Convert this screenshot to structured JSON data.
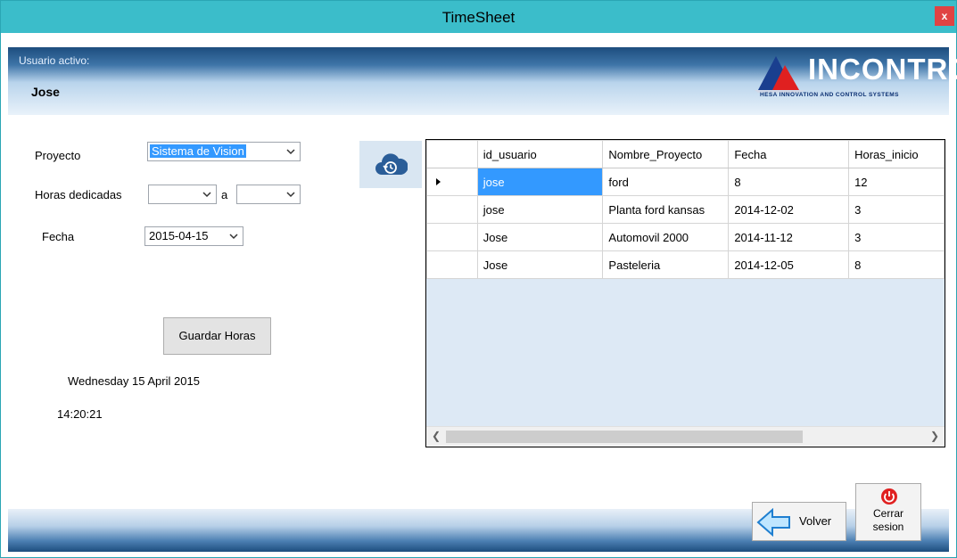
{
  "window": {
    "title": "TimeSheet",
    "close_glyph": "x"
  },
  "header": {
    "user_label": "Usuario activo:",
    "user_name": "Jose",
    "logo": {
      "brand": "INCONTROL",
      "tagline": "HESA INNOVATION AND CONTROL SYSTEMS"
    }
  },
  "form": {
    "proyecto_label": "Proyecto",
    "proyecto_value": "Sistema de Vision",
    "horas_label": "Horas dedicadas",
    "horas_desde": "",
    "horas_sep": "a",
    "horas_hasta": "",
    "fecha_label": "Fecha",
    "fecha_value": "2015-04-15",
    "save_button": "Guardar Horas",
    "date_display": "Wednesday 15 April 2015",
    "time_display": "14:20:21"
  },
  "grid": {
    "columns": [
      "id_usuario",
      "Nombre_Proyecto",
      "Fecha",
      "Horas_inicio"
    ],
    "rows": [
      [
        "jose",
        "ford",
        "8",
        "12"
      ],
      [
        "jose",
        "Planta ford kansas",
        "2014-12-02",
        "3"
      ],
      [
        "Jose",
        "Automovil 2000",
        "2014-11-12",
        "3"
      ],
      [
        "Jose",
        "Pasteleria",
        "2014-12-05",
        "8"
      ]
    ]
  },
  "footer": {
    "back_label": "Volver",
    "logout_line1": "Cerrar",
    "logout_line2": "sesion"
  },
  "colors": {
    "titlebar": "#3bbdca",
    "selection": "#3399ff",
    "logo_red": "#e02020",
    "close": "#e04343"
  }
}
